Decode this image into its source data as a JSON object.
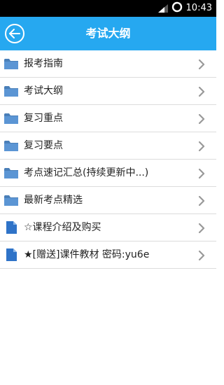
{
  "status_bar": {
    "time": "10:43",
    "icons": [
      "signal-icon",
      "battery-ring-icon"
    ]
  },
  "header": {
    "title": "考试大纲",
    "back_icon": "back-arrow-circle-icon"
  },
  "colors": {
    "accent": "#26a8f0",
    "status_bar": "#000000",
    "folder_icon": "#4a7fb8",
    "document_icon": "#2f73c8",
    "chevron": "#999999",
    "divider": "#dcdcdc"
  },
  "items": [
    {
      "label": "报考指南",
      "icon": "folder-icon"
    },
    {
      "label": "考试大纲",
      "icon": "folder-icon"
    },
    {
      "label": "复习重点",
      "icon": "folder-icon"
    },
    {
      "label": "复习要点",
      "icon": "folder-icon"
    },
    {
      "label": "考点速记汇总(持续更新中...)",
      "icon": "folder-icon"
    },
    {
      "label": "最新考点精选",
      "icon": "folder-icon"
    },
    {
      "label": "☆课程介绍及购买",
      "icon": "document-icon"
    },
    {
      "label": "★[赠送]课件教材 密码:yu6e",
      "icon": "document-icon"
    }
  ]
}
